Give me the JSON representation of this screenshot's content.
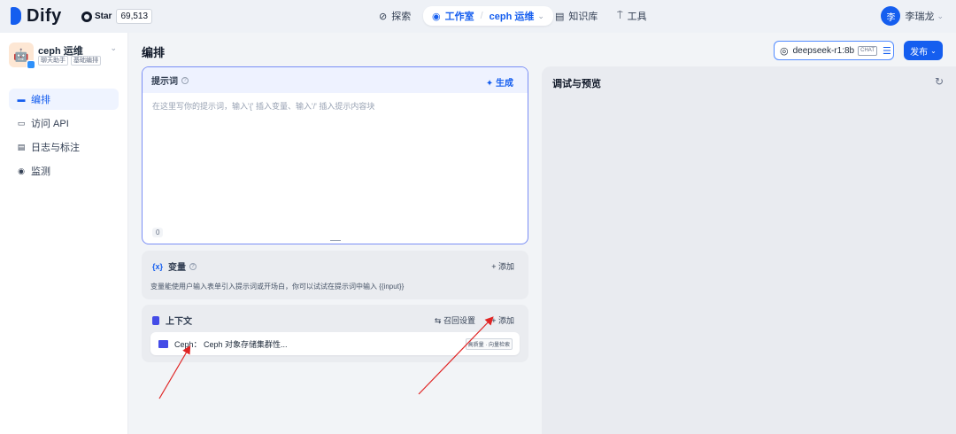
{
  "header": {
    "logo_text": "Dify",
    "github": {
      "label": "Star",
      "count": "69,513"
    },
    "nav": {
      "explore": "探索",
      "studio": "工作室",
      "app_name": "ceph 运维",
      "knowledge": "知识库",
      "tools": "工具"
    },
    "user": {
      "avatar_initial": "李",
      "name": "李瑞龙"
    }
  },
  "sidebar": {
    "app": {
      "name": "ceph 运维",
      "tags": [
        "聊天助手",
        "基础编排"
      ]
    },
    "items": [
      {
        "label": "编排",
        "icon": "layout-icon",
        "active": true
      },
      {
        "label": "访问 API",
        "icon": "terminal-icon",
        "active": false
      },
      {
        "label": "日志与标注",
        "icon": "file-list-icon",
        "active": false
      },
      {
        "label": "监测",
        "icon": "dashboard-icon",
        "active": false
      }
    ]
  },
  "main": {
    "title": "编排",
    "model": {
      "name": "deepseek-r1:8b",
      "badge": "CHAT"
    },
    "publish_label": "发布",
    "prompt": {
      "label": "提示词",
      "generate_label": "生成",
      "placeholder": "在这里写你的提示词，输入'{' 插入变量、输入'/' 插入提示内容块",
      "char_count": "0"
    },
    "variables": {
      "icon_text": "{x}",
      "label": "变量",
      "add_label": "添加",
      "description": "变量能使用户输入表单引入提示词或开场白，你可以试试在提示词中输入 {{input}}"
    },
    "context": {
      "label": "上下文",
      "recall_label": "召回设置",
      "add_label": "添加",
      "dataset": {
        "name": "Ceph：  Ceph 对象存储集群性...",
        "tags": "高质量 · 向量检索"
      }
    }
  },
  "debug": {
    "title": "调试与预览"
  },
  "colors": {
    "accent": "#155eef",
    "prompt_border": "#7a8ef5",
    "arrow": "#e02424"
  }
}
